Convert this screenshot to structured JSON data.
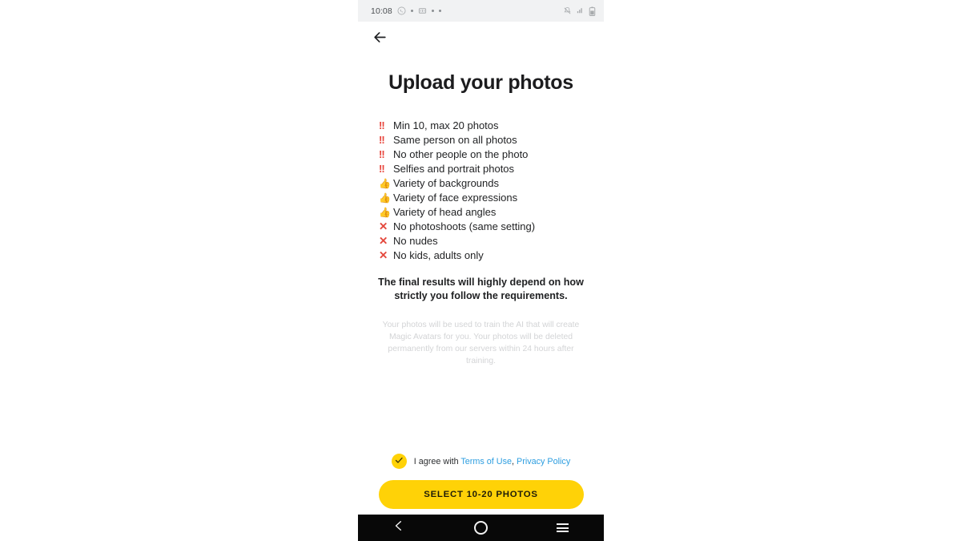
{
  "status_bar": {
    "clock": "10:08",
    "left_icons": [
      "whatsapp-icon",
      "dot-icon",
      "messaging-icon",
      "dot-icon",
      "dot-icon"
    ],
    "right_icons": [
      "vibrate-mute-icon",
      "signal-icon",
      "battery-icon"
    ],
    "background": "#f1f2f3"
  },
  "app_bar": {
    "back_icon": "back-arrow-icon"
  },
  "main": {
    "title": "Upload your photos",
    "requirements": [
      {
        "icon": "double-exclamation-icon",
        "icon_glyph": "!!",
        "icon_kind": "ex",
        "label": "Min 10, max 20 photos"
      },
      {
        "icon": "double-exclamation-icon",
        "icon_glyph": "!!",
        "icon_kind": "ex",
        "label": "Same person on all photos"
      },
      {
        "icon": "double-exclamation-icon",
        "icon_glyph": "!!",
        "icon_kind": "ex",
        "label": "No other people on the photo"
      },
      {
        "icon": "double-exclamation-icon",
        "icon_glyph": "!!",
        "icon_kind": "ex",
        "label": "Selfies and portrait photos"
      },
      {
        "icon": "thumbs-up-icon",
        "icon_glyph": "👍",
        "icon_kind": "thumb",
        "label": "Variety of backgrounds"
      },
      {
        "icon": "thumbs-up-icon",
        "icon_glyph": "👍",
        "icon_kind": "thumb",
        "label": "Variety of face expressions"
      },
      {
        "icon": "thumbs-up-icon",
        "icon_glyph": "👍",
        "icon_kind": "thumb",
        "label": "Variety of head angles"
      },
      {
        "icon": "cross-mark-icon",
        "icon_glyph": "✕",
        "icon_kind": "cross",
        "label": "No photoshoots (same setting)"
      },
      {
        "icon": "cross-mark-icon",
        "icon_glyph": "✕",
        "icon_kind": "cross",
        "label": "No nudes"
      },
      {
        "icon": "cross-mark-icon",
        "icon_glyph": "✕",
        "icon_kind": "cross",
        "label": "No kids, adults only"
      }
    ],
    "emphasis": "The final results will highly depend on how strictly you follow the requirements.",
    "fineprint": "Your photos will be used to train the AI that will create Magic Avatars for you. Your photos will be deleted permanently from our servers within 24 hours after training."
  },
  "actions": {
    "checkbox_checked": true,
    "checkbox_icon": "check-icon",
    "agree_prefix": "I agree with ",
    "terms_link": "Terms of Use",
    "links_separator": ", ",
    "privacy_link": "Privacy Policy",
    "cta_label": "SELECT 10-20 PHOTOS"
  },
  "nav_bar": {
    "back_icon": "nav-back-icon",
    "home_icon": "nav-home-icon",
    "recents_icon": "nav-recents-icon"
  },
  "colors": {
    "accent_yellow": "#ffd207",
    "link_blue": "#2d9ee0",
    "alert_red": "#e8453c",
    "text_dark": "#1f2022",
    "fineprint_gray": "#d3d4d6",
    "nav_black": "#080808"
  }
}
